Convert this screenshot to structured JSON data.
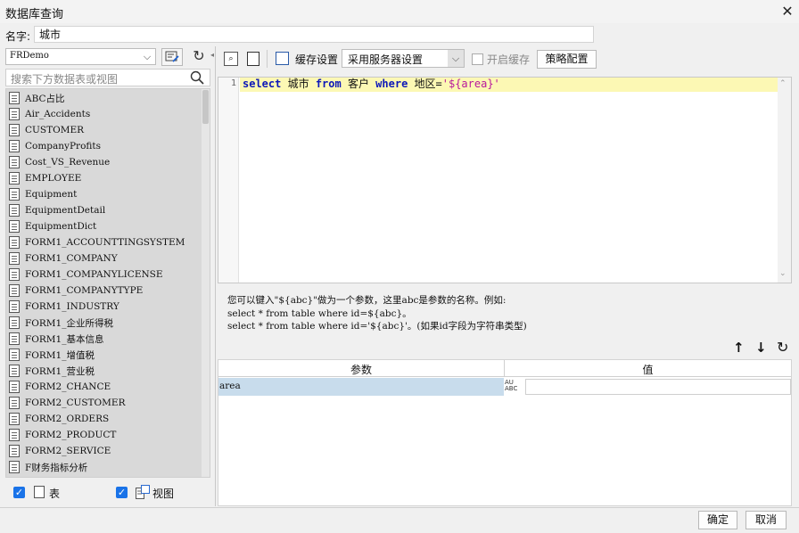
{
  "window": {
    "title": "数据库查询",
    "close_glyph": "✕"
  },
  "name_field": {
    "label": "名字:",
    "value": "城市"
  },
  "datasource": {
    "selected": "FRDemo",
    "search_placeholder": "搜索下方数据表或视图"
  },
  "tables": [
    "ABC占比",
    "Air_Accidents",
    "CUSTOMER",
    "CompanyProfits",
    "Cost_VS_Revenue",
    "EMPLOYEE",
    "Equipment",
    "EquipmentDetail",
    "EquipmentDict",
    "FORM1_ACCOUNTTINGSYSTEM",
    "FORM1_COMPANY",
    "FORM1_COMPANYLICENSE",
    "FORM1_COMPANYTYPE",
    "FORM1_INDUSTRY",
    "FORM1_企业所得税",
    "FORM1_基本信息",
    "FORM1_增值税",
    "FORM1_营业税",
    "FORM2_CHANCE",
    "FORM2_CUSTOMER",
    "FORM2_ORDERS",
    "FORM2_PRODUCT",
    "FORM2_SERVICE",
    "F财务指标分析"
  ],
  "filters": {
    "table_label": "表",
    "view_label": "视图"
  },
  "toolbar": {
    "cache_label": "缓存设置",
    "cache_option": "采用服务器设置",
    "enable_cache_label": "开启缓存",
    "strategy_label": "策略配置"
  },
  "editor": {
    "line_number": "1",
    "tokens": [
      {
        "text": "select",
        "type": "kw"
      },
      {
        "text": " 城市 ",
        "type": "plain"
      },
      {
        "text": "from",
        "type": "kw"
      },
      {
        "text": " 客户 ",
        "type": "plain"
      },
      {
        "text": "where",
        "type": "kw"
      },
      {
        "text": " 地区=",
        "type": "plain"
      },
      {
        "text": "'${area}'",
        "type": "str"
      }
    ]
  },
  "hint": {
    "line1": "您可以键入\"${abc}\"做为一个参数，这里abc是参数的名称。例如:",
    "line2": "select * from table where id=${abc}。",
    "line3": "select * from table where id='${abc}'。(如果id字段为字符串类型)"
  },
  "params": {
    "columns": [
      "参数",
      "值"
    ],
    "rows": [
      {
        "name": "area",
        "type_badge": "AU\nABC",
        "value": ""
      }
    ]
  },
  "footer": {
    "ok_label": "确定",
    "cancel_label": "取消"
  }
}
